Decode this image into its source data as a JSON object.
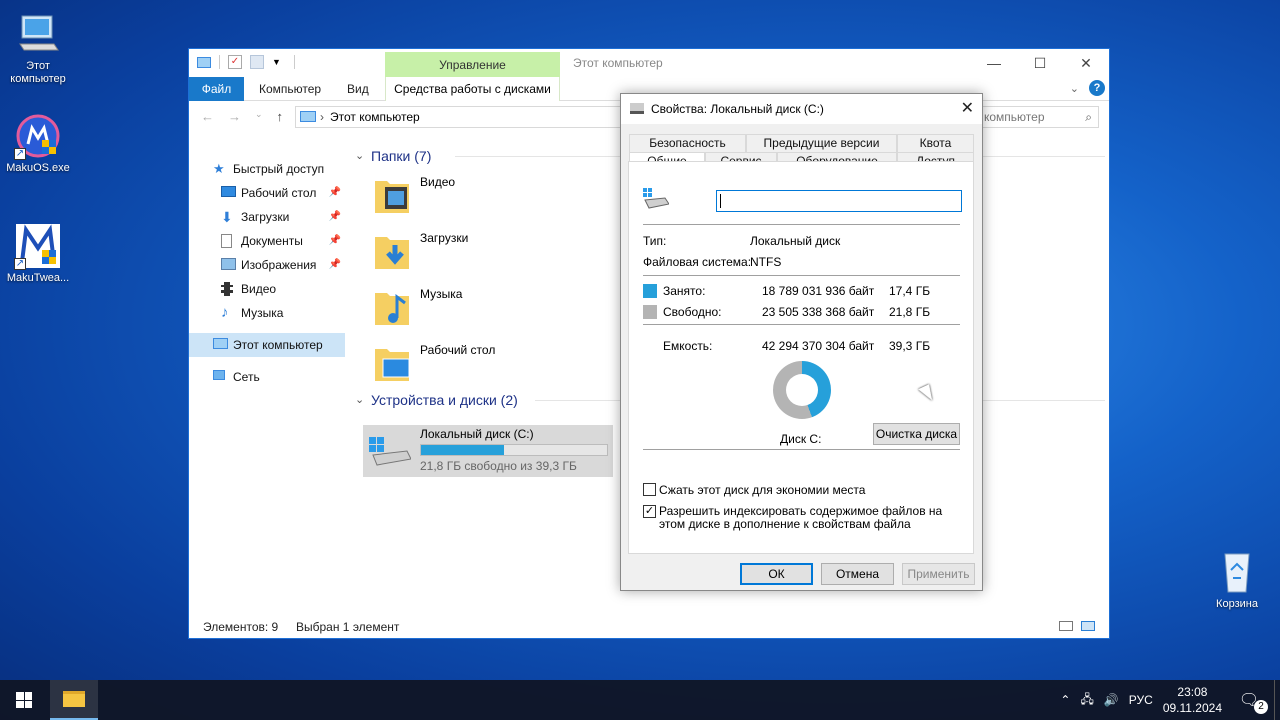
{
  "desktop": {
    "icons": [
      {
        "label": "Этот компьютер"
      },
      {
        "label": "MakuOS.exe"
      },
      {
        "label": "MakuTwea..."
      },
      {
        "label": "Корзина"
      }
    ]
  },
  "explorer": {
    "title": "Этот компьютер",
    "manage_tab": "Управление",
    "ribbon": {
      "file": "Файл",
      "computer": "Компьютер",
      "view": "Вид",
      "disk_tools": "Средства работы с дисками"
    },
    "address": "Этот компьютер",
    "search_placeholder": "компьютер",
    "nav": {
      "quick_access": "Быстрый доступ",
      "items": [
        {
          "label": "Рабочий стол"
        },
        {
          "label": "Загрузки"
        },
        {
          "label": "Документы"
        },
        {
          "label": "Изображения"
        },
        {
          "label": "Видео"
        },
        {
          "label": "Музыка"
        }
      ],
      "this_pc": "Этот компьютер",
      "network": "Сеть"
    },
    "folders_header": "Папки (7)",
    "folders": [
      {
        "name": "Видео"
      },
      {
        "name": "Загрузки"
      },
      {
        "name": "Музыка"
      },
      {
        "name": "Рабочий стол"
      }
    ],
    "devices_header": "Устройства и диски (2)",
    "drive": {
      "name": "Локальный диск (C:)",
      "free_text": "21,8 ГБ свободно из 39,3 ГБ",
      "used_fraction": 0.444
    },
    "status": {
      "items": "Элементов: 9",
      "selected": "Выбран 1 элемент"
    }
  },
  "properties": {
    "title": "Свойства: Локальный диск (C:)",
    "tabs_row1": [
      "Безопасность",
      "Предыдущие версии",
      "Квота"
    ],
    "tabs_row2": [
      "Общие",
      "Сервис",
      "Оборудование",
      "Доступ"
    ],
    "name_value": "",
    "type_label": "Тип:",
    "type_value": "Локальный диск",
    "fs_label": "Файловая система:",
    "fs_value": "NTFS",
    "used_label": "Занято:",
    "used_bytes": "18 789 031 936 байт",
    "used_gb": "17,4 ГБ",
    "free_label": "Свободно:",
    "free_bytes": "23 505 338 368 байт",
    "free_gb": "21,8 ГБ",
    "capacity_label": "Емкость:",
    "capacity_bytes": "42 294 370 304 байт",
    "capacity_gb": "39,3 ГБ",
    "disk_label": "Диск C:",
    "cleanup_button": "Очистка диска",
    "compress_label": "Сжать этот диск для экономии места",
    "compress_checked": false,
    "index_label": "Разрешить индексировать содержимое файлов на этом диске в дополнение к свойствам файла",
    "index_checked": true,
    "ok": "ОК",
    "cancel": "Отмена",
    "apply": "Применить",
    "colors": {
      "used": "#26a0da",
      "free": "#b4b4b4"
    }
  },
  "taskbar": {
    "language": "РУС",
    "time": "23:08",
    "date": "09.11.2024",
    "notifications": "2"
  }
}
